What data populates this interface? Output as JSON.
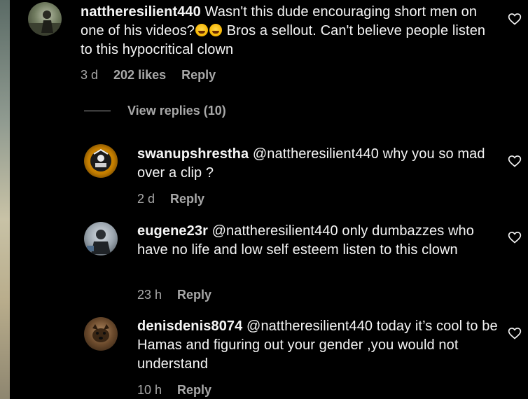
{
  "comments": [
    {
      "username": "nattheresilient440",
      "text_before_emoji": "Wasn't this dude encouraging short men on one of his videos?",
      "emoji": "😂😂",
      "text_after_emoji": " Bros a sellout. Can't believe people listen to this hypocritical clown",
      "time": "3 d",
      "likes": "202 likes",
      "reply": "Reply"
    }
  ],
  "view_replies": "View replies (10)",
  "replies": [
    {
      "username": "swanupshrestha",
      "mention": "@nattheresilient440",
      "text": " why you so mad over a clip ?",
      "time": "2 d",
      "reply": "Reply"
    },
    {
      "username": "eugene23r",
      "mention": "@nattheresilient440",
      "text": " only dumbazzes who have no life and low self esteem listen to this clown",
      "time": "23 h",
      "reply": "Reply"
    },
    {
      "username": "denisdenis8074",
      "mention": "@nattheresilient440",
      "text": " today it’s cool to be Hamas and figuring out your gender ,you would not understand",
      "time": "10 h",
      "reply": "Reply"
    }
  ],
  "icons": {
    "like": "heart-outline-icon",
    "emoji": "face-with-tears-of-joy-emoji"
  },
  "colors": {
    "background": "#000000",
    "text": "#f5f5f5",
    "secondary_text": "#a8a8a8"
  }
}
